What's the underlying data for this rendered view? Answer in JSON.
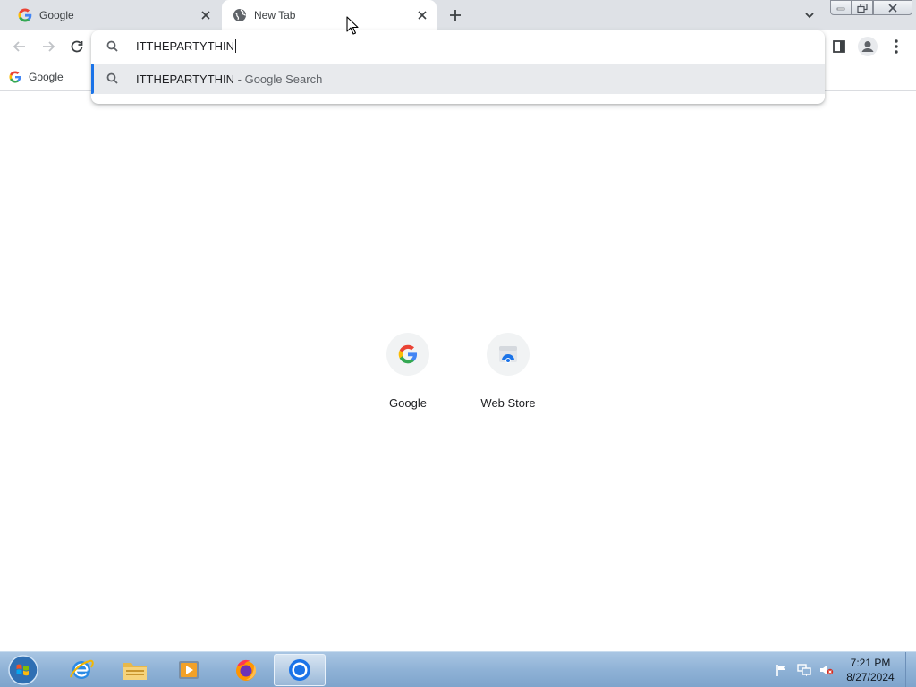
{
  "browser": {
    "tabs": [
      {
        "title": "Google",
        "active": false
      },
      {
        "title": "New Tab",
        "active": true
      }
    ]
  },
  "bookmarks": [
    {
      "label": "Google"
    }
  ],
  "omnibox": {
    "query": "ITTHEPARTYTHIN",
    "suggestion": {
      "text": "ITTHEPARTYTHIN",
      "separator": " - ",
      "subtext": "Google Search"
    }
  },
  "shortcuts": [
    {
      "label": "Google",
      "icon": "google-logo-icon"
    },
    {
      "label": "Web Store",
      "icon": "web-store-icon"
    }
  ],
  "taskbar": {
    "apps": [
      "internet-explorer",
      "file-explorer",
      "media-player",
      "firefox",
      "chrome"
    ],
    "active_app": "chrome",
    "time": "7:21 PM",
    "date": "8/27/2024"
  },
  "colors": {
    "accent": "#1a73e8",
    "tabstrip": "#dee1e6",
    "suggestion_bg": "#e8eaed"
  }
}
